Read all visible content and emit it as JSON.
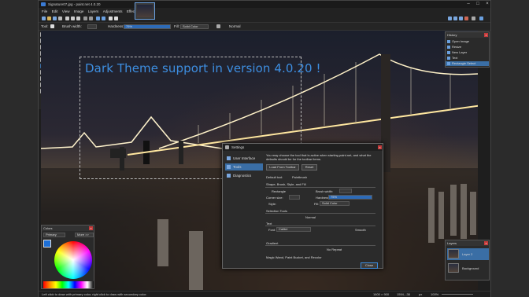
{
  "window": {
    "title": "Signature07.jpg - paint.net 4.0.20"
  },
  "menu": [
    "File",
    "Edit",
    "View",
    "Image",
    "Layers",
    "Adjustments",
    "Effects"
  ],
  "options": {
    "tool_label": "Tool:",
    "brush_width_label": "Brush width:",
    "hardness_label": "Hardness:",
    "hardness_value": "75%",
    "fill_label": "Fill:",
    "fill_value": "Solid Color",
    "blend_value": "Normal"
  },
  "headline": "Dark Theme support in version 4.0.20 !",
  "history": {
    "title": "History",
    "items": [
      "Open Image",
      "Resize",
      "New Layer",
      "Text",
      "Rectangle Select"
    ]
  },
  "layers": {
    "title": "Layers",
    "items": [
      "Layer 2",
      "Background"
    ]
  },
  "colors": {
    "title": "Colors",
    "mode": "Primary",
    "more": "More >>"
  },
  "settings": {
    "title": "Settings",
    "nav": [
      "User Interface",
      "Tools",
      "Diagnostics"
    ],
    "description": "You may choose the tool that is active when starting paint.net, and what the defaults should be for the toolbar items.",
    "load_button": "Load From Toolbar",
    "reset_button": "Reset",
    "default_tool_label": "Default tool:",
    "default_tool_value": "Paintbrush",
    "shape_section": "Shape, Brush, Style, and Fill",
    "shape_value": "Rectangle",
    "brush_width_label": "Brush width:",
    "corner_label": "Corner size:",
    "hardness_label": "Hardness:",
    "hardness_value": "75%",
    "style_label": "Style:",
    "fill_label": "Fill:",
    "fill_value": "Solid Color",
    "selection_section": "Selection Tools",
    "selection_mode": "Normal",
    "text_section": "Text",
    "font_label": "Font:",
    "font_value": "Calibri",
    "smooth_value": "Smooth",
    "gradient_section": "Gradient",
    "repeat_value": "No Repeat",
    "magic_section": "Magic Wand, Paint Bucket, and Recolor",
    "close_button": "Close"
  },
  "status": {
    "hint": "Left click to draw with primary color, right click to draw with secondary color.",
    "size": "1600 × 900",
    "cursor": "1594, -38",
    "unit": "px",
    "zoom": "100%"
  }
}
